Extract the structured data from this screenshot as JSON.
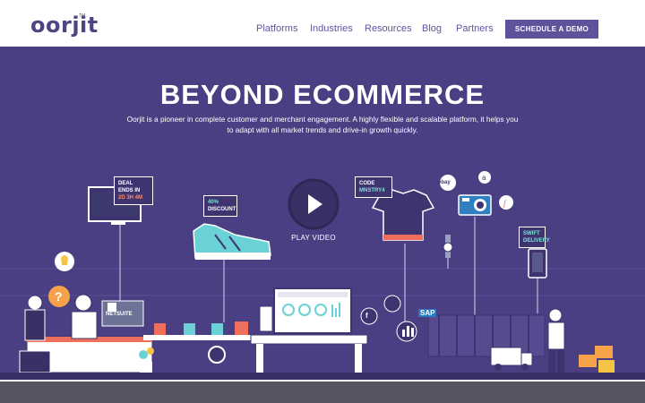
{
  "brand": {
    "logo_text": "oorjit",
    "tm": "TM"
  },
  "nav": {
    "items": [
      {
        "label": "Platforms"
      },
      {
        "label": "Industries"
      },
      {
        "label": "Resources"
      },
      {
        "label": "Blog"
      },
      {
        "label": "Partners"
      }
    ],
    "cta_label": "SCHEDULE A DEMO"
  },
  "hero": {
    "headline": "BEYOND ECOMMERCE",
    "subtitle": "Oorjit is a pioneer in complete customer and merchant engagement. A highly flexible and scalable platform, it helps you to adapt with all market trends and drive-in growth quickly.",
    "play_label": "PLAY VIDEO",
    "tags": {
      "deal_line1": "DEAL ENDS IN",
      "deal_line2": "2D 3H 4M",
      "discount_line1": "40%",
      "discount_line2": "DISCOUNT",
      "code_line1": "CODE",
      "code_line2": "MNSTRY4",
      "swift_line1": "SWIFT",
      "swift_line2": "DELIVERY"
    },
    "logos": {
      "netsuite": "NETSUITE",
      "sap": "SAP",
      "ebay": "ebay",
      "facebook": "f"
    }
  },
  "colors": {
    "brand_purple": "#4e4682",
    "hero_bg": "#4b3f83",
    "cta_bg": "#5d539b",
    "accent_teal": "#7fe0d9",
    "accent_coral": "#ff8a6a"
  }
}
